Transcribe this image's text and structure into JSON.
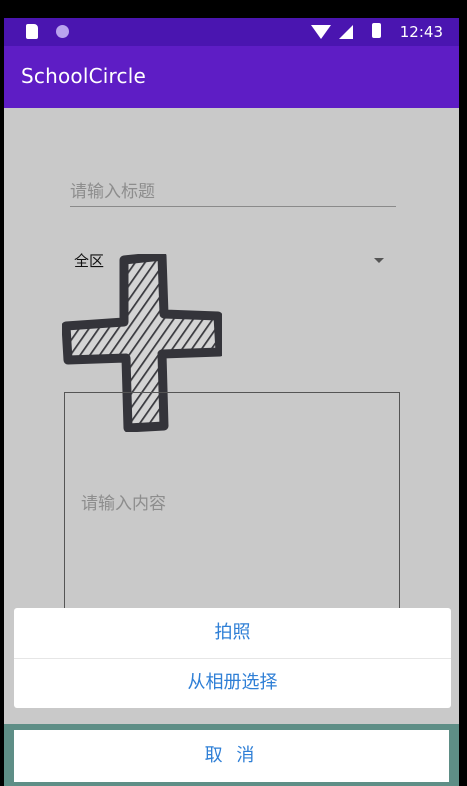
{
  "status_bar": {
    "time": "12:43"
  },
  "app_bar": {
    "title": "SchoolCircle"
  },
  "form": {
    "title_placeholder": "请输入标题",
    "region_value": "全区",
    "content_placeholder": "请输入内容"
  },
  "action_sheet": {
    "take_photo": "拍照",
    "choose_album": "从相册选择",
    "cancel": "取 消"
  },
  "colors": {
    "status_bar": "#4a15b0",
    "app_bar": "#5e1dc5",
    "action_text": "#2f7fd6"
  },
  "icons": [
    "sd-card-icon",
    "notification-circle-icon",
    "wifi-icon",
    "signal-icon",
    "battery-icon",
    "dropdown-arrow-icon",
    "add-image-plus-icon"
  ]
}
